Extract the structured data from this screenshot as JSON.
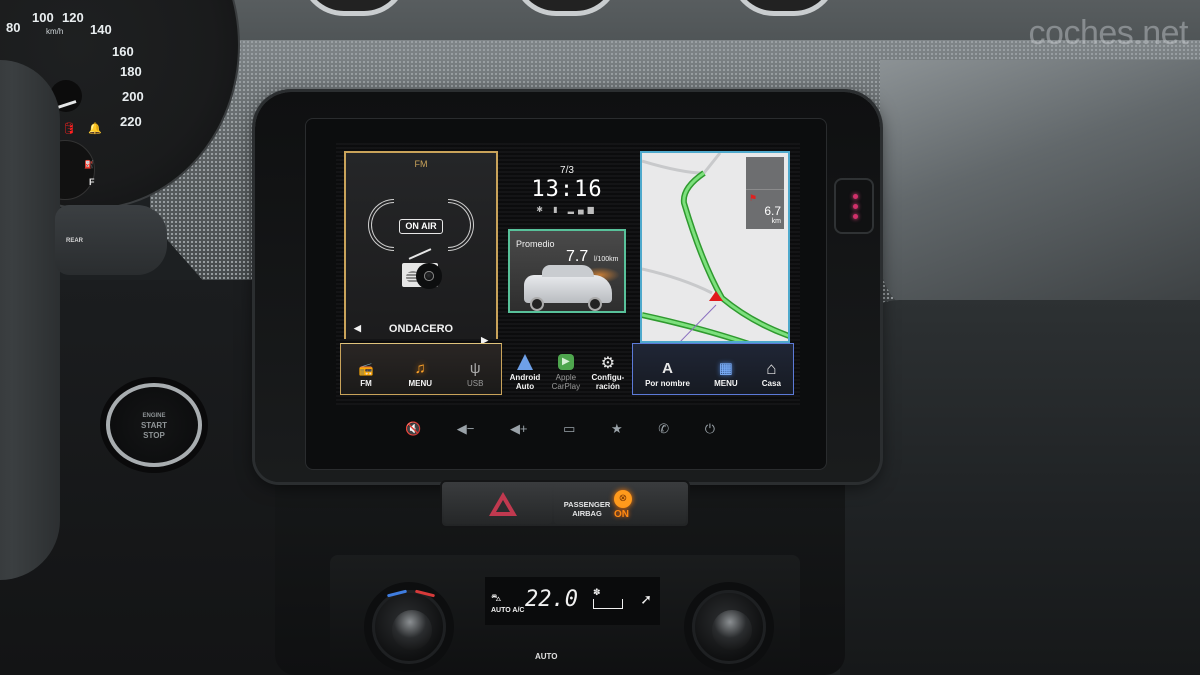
{
  "watermark": "coches.net",
  "cluster": {
    "speed_ticks": [
      "80",
      "100",
      "120",
      "140",
      "160",
      "180",
      "200",
      "220"
    ],
    "unit": "km/h",
    "fuel_label": "F",
    "warnings": [
      "oil-pressure-icon",
      "seatbelt-bell-icon"
    ]
  },
  "stalk": {
    "label": "REAR"
  },
  "start_button": {
    "line1": "ENGINE",
    "line2": "START",
    "line3": "STOP"
  },
  "screen": {
    "radio": {
      "band": "FM",
      "on_air": "ON AIR",
      "station": "ONDACERO",
      "prev": "◀",
      "next": "▶"
    },
    "clock": {
      "date": "7/3",
      "time": "13:16",
      "status": "✱ ▮ ▂▄▆"
    },
    "eco": {
      "title": "Promedio",
      "value": "7.7",
      "unit": "l/100km"
    },
    "map": {
      "distance": "6.7",
      "distance_unit": "km",
      "flag_icon": "destination-flag-icon"
    },
    "dock_left": [
      {
        "icon": "📻",
        "label": "FM"
      },
      {
        "icon": "♫",
        "label": "MENU"
      },
      {
        "icon": "ψ",
        "label": "USB"
      }
    ],
    "dock_mid": [
      {
        "label_1": "Android",
        "label_2": "Auto"
      },
      {
        "label_1": "Apple",
        "label_2": "CarPlay",
        "icon": "▶"
      },
      {
        "icon": "⚙",
        "label_1": "Configu-",
        "label_2": "ración"
      }
    ],
    "dock_right": [
      {
        "icon": "A",
        "label": "Por nombre"
      },
      {
        "icon": "▦",
        "label": "MENU"
      },
      {
        "icon": "⌂",
        "label": "Casa"
      }
    ]
  },
  "hardware_buttons": [
    {
      "name": "mute",
      "glyph": "🔇"
    },
    {
      "name": "volume-down",
      "glyph": "◀−"
    },
    {
      "name": "volume-up",
      "glyph": "◀+"
    },
    {
      "name": "screen",
      "glyph": "▭"
    },
    {
      "name": "favorite",
      "glyph": "★"
    },
    {
      "name": "phone",
      "glyph": "✆"
    },
    {
      "name": "power",
      "glyph": "⏻"
    }
  ],
  "switches": {
    "airbag_line1": "PASSENGER",
    "airbag_line2": "AIRBAG",
    "airbag_state": "ON",
    "airbag_icon_glyph": "⊗"
  },
  "climate": {
    "temperature": "22.0",
    "mode_label": "AUTO A/C",
    "auto_button": "AUTO",
    "fan_glyph": "✽",
    "airflow_glyph": "➚",
    "car_glyph": "⛍"
  },
  "colors": {
    "radio_accent": "#c9a35a",
    "eco_accent": "#58c19a",
    "nav_accent": "#5c7ad8",
    "route_green": "#5fd35f",
    "airbag_amber": "#ff8a12"
  }
}
